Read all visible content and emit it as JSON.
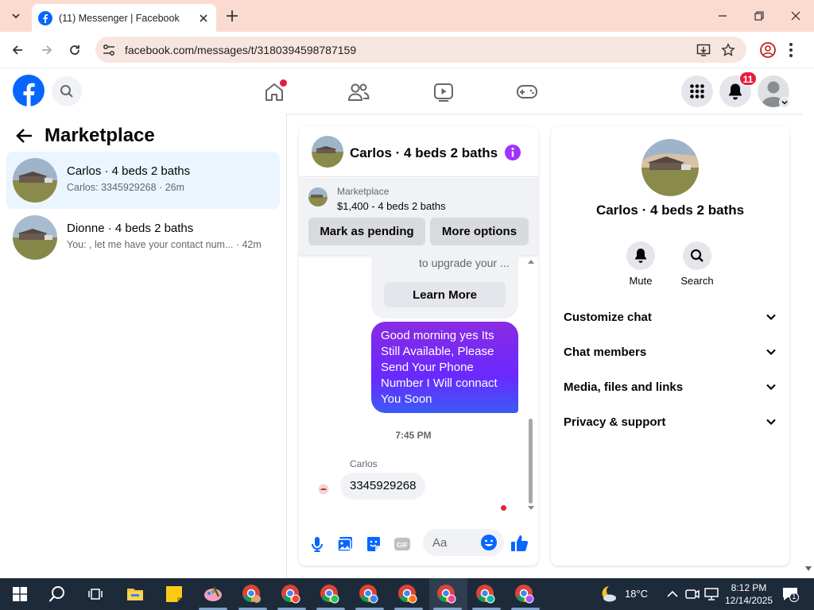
{
  "browser": {
    "tab_title": "(11) Messenger | Facebook",
    "url": "facebook.com/messages/t/3180394598787159"
  },
  "header": {
    "notifications_count": "11"
  },
  "sidebar": {
    "title": "Marketplace",
    "conversations": [
      {
        "name": "Carlos · 4 beds 2 baths",
        "snippet": "Carlos: 3345929268 · 26m",
        "selected": true
      },
      {
        "name": "Dionne · 4 beds 2 baths",
        "snippet": "You: , let me have your contact num... · 42m",
        "selected": false
      }
    ]
  },
  "chat": {
    "title": "Carlos · 4 beds 2 baths",
    "marketplace_label": "Marketplace",
    "listing": "$1,400 - 4 beds 2 baths",
    "mark_pending_label": "Mark as pending",
    "more_options_label": "More options",
    "card_text": "to upgrade your ...",
    "learn_more_label": "Learn More",
    "sent_message": "Good morning yes Its Still Available, Please Send Your Phone Number I Will connact You Soon",
    "timestamp": "7:45 PM",
    "sender_name": "Carlos",
    "received_message": "3345929268",
    "input_placeholder": "Aa"
  },
  "details": {
    "name": "Carlos · 4 beds 2 baths",
    "mute_label": "Mute",
    "search_label": "Search",
    "sections": [
      "Customize chat",
      "Chat members",
      "Media, files and links",
      "Privacy & support"
    ]
  },
  "taskbar": {
    "temperature": "18°C",
    "time": "8:12 PM",
    "date": "12/14/2025",
    "notif_count": "1"
  },
  "colors": {
    "fb_blue": "#0866ff",
    "messenger_purple": "#a033ff",
    "selected_row": "#ebf5ff"
  }
}
